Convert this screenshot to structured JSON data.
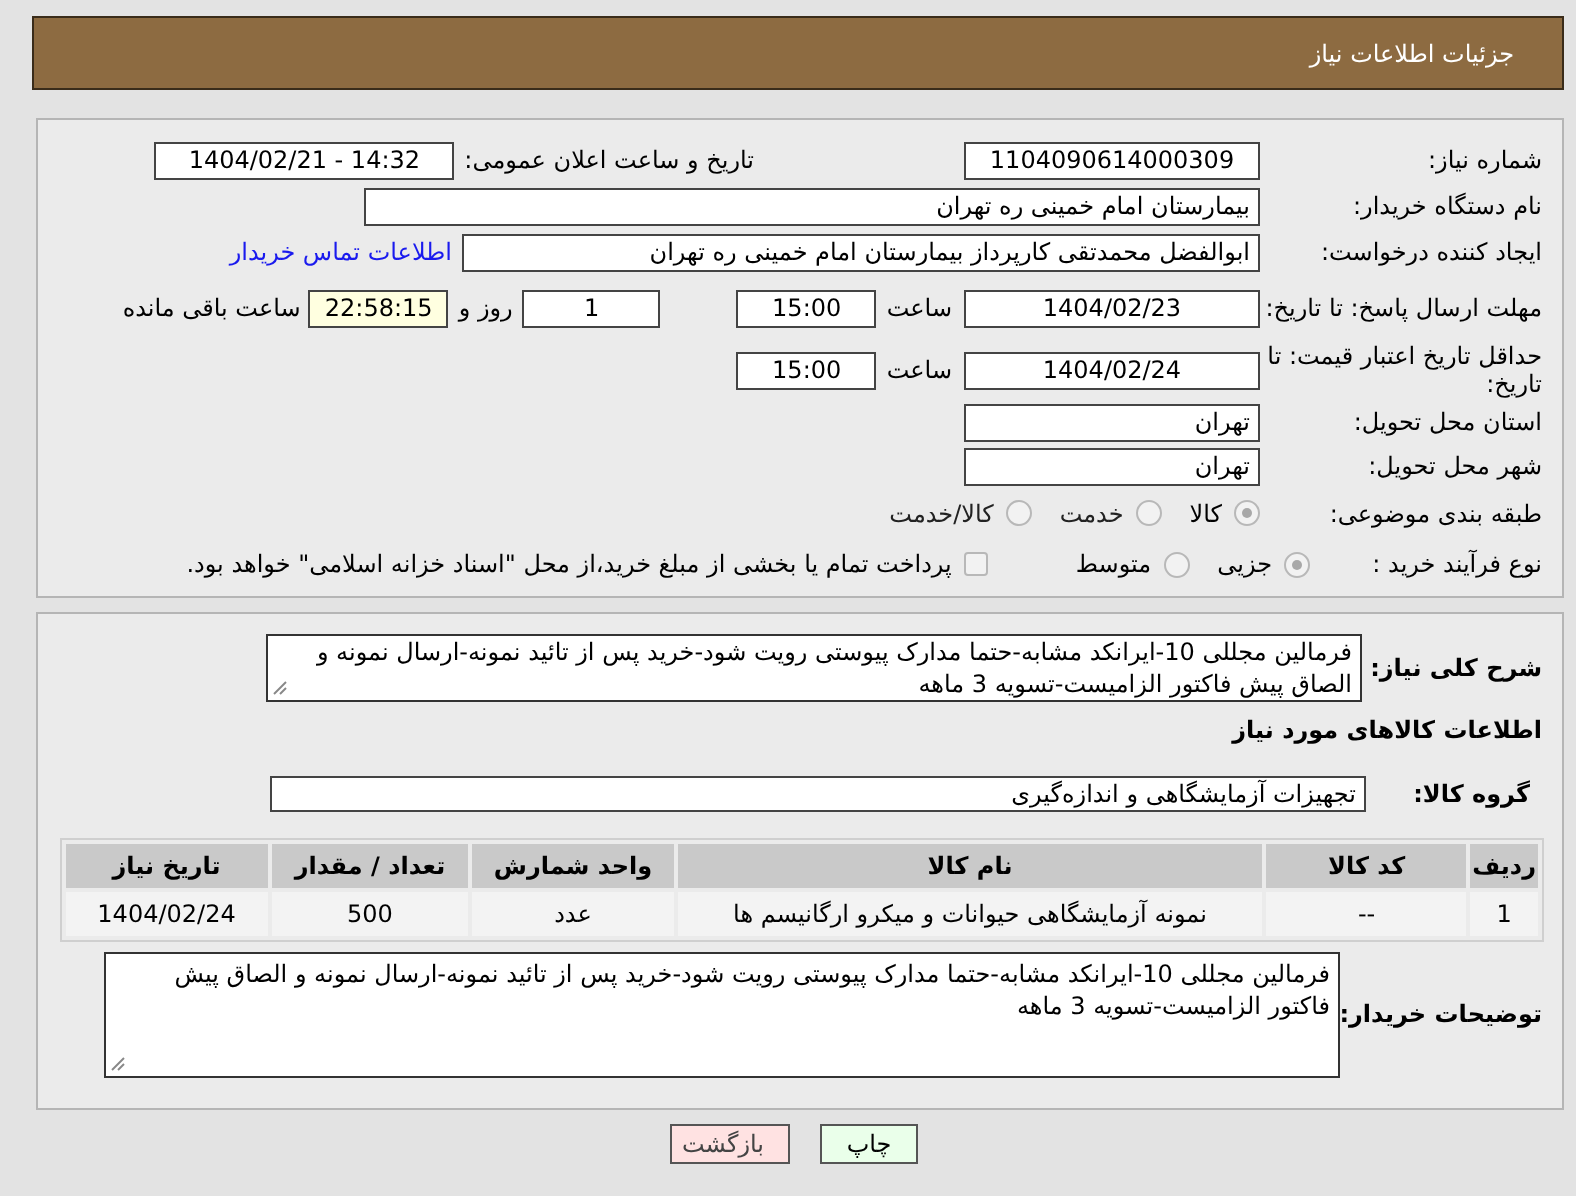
{
  "header": {
    "title": "جزئیات اطلاعات نیاز"
  },
  "need_number": {
    "label": "شماره نیاز:",
    "value": "1104090614000309"
  },
  "announce_datetime": {
    "label": "تاریخ و ساعت اعلان عمومی:",
    "value": "1404/02/21 - 14:32"
  },
  "buyer_org": {
    "label": "نام دستگاه خریدار:",
    "value": "بیمارستان امام خمینی ره  تهران"
  },
  "requester": {
    "label": "ایجاد کننده درخواست:",
    "value": "ابوالفضل محمدتقی کارپرداز بیمارستان امام خمینی ره  تهران",
    "contact_link": "اطلاعات تماس خریدار"
  },
  "response_deadline": {
    "label": "مهلت ارسال پاسخ: تا تاریخ:",
    "date": "1404/02/23",
    "time_label": "ساعت",
    "time": "15:00",
    "days": "1",
    "days_label": "روز و",
    "remaining": "22:58:15",
    "remaining_label": "ساعت باقی مانده"
  },
  "price_validity": {
    "label": "حداقل تاریخ اعتبار قیمت: تا تاریخ:",
    "date": "1404/02/24",
    "time_label": "ساعت",
    "time": "15:00"
  },
  "delivery_province": {
    "label": "استان محل تحویل:",
    "value": "تهران"
  },
  "delivery_city": {
    "label": "شهر محل تحویل:",
    "value": "تهران"
  },
  "category": {
    "label": "طبقه بندی موضوعی:",
    "options": [
      {
        "label": "کالا",
        "selected": true
      },
      {
        "label": "خدمت",
        "selected": false
      },
      {
        "label": "کالا/خدمت",
        "selected": false
      }
    ]
  },
  "purchase_process": {
    "label": "نوع فرآیند خرید :",
    "options": [
      {
        "label": "جزیی",
        "selected": true
      },
      {
        "label": "متوسط",
        "selected": false
      }
    ],
    "treasury_payment": {
      "checked": false,
      "label": "پرداخت تمام یا بخشی از مبلغ خرید،از محل \"اسناد خزانه اسلامی\" خواهد بود."
    }
  },
  "description": {
    "label": "شرح کلی نیاز:",
    "text": "فرمالین مجللی 10-ایرانکد مشابه-حتما مدارک پیوستی رویت شود-خرید پس از تائید نمونه-ارسال نمونه و الصاق پیش فاکتور الزامیست-تسویه 3 ماهه"
  },
  "items_section": {
    "title": "اطلاعات کالاهای مورد نیاز",
    "group_label": "گروه کالا:",
    "group": "تجهیزات آزمایشگاهی و اندازه‌گیری"
  },
  "table": {
    "columns": [
      "ردیف",
      "کد کالا",
      "نام کالا",
      "واحد شمارش",
      "تعداد / مقدار",
      "تاریخ نیاز"
    ],
    "rows": [
      [
        "1",
        "--",
        "نمونه آزمایشگاهی حیوانات و میکرو ارگانیسم ها",
        "عدد",
        "500",
        "1404/02/24"
      ]
    ]
  },
  "buyer_notes": {
    "label": "توضیحات خریدار:",
    "text": "فرمالین مجللی 10-ایرانکد مشابه-حتما مدارک پیوستی رویت شود-خرید پس از تائید نمونه-ارسال نمونه و الصاق پیش فاکتور الزامیست-تسویه 3 ماهه"
  },
  "buttons": [
    {
      "label": "چاپ",
      "kind": "print"
    },
    {
      "label": "بازگشت",
      "kind": "back"
    }
  ]
}
